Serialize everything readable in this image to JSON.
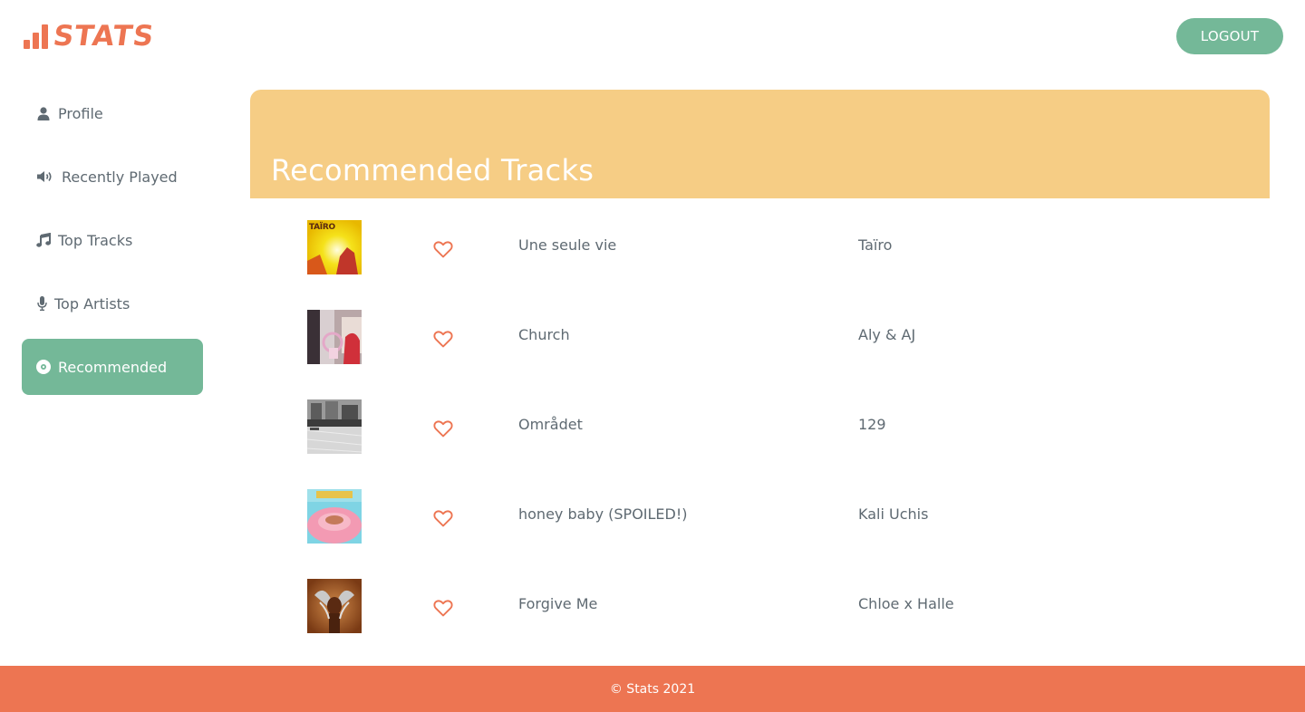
{
  "header": {
    "logo_text": "STATS",
    "logout_label": "LOGOUT"
  },
  "sidebar": {
    "items": [
      {
        "label": "Profile",
        "icon": "user-icon"
      },
      {
        "label": "Recently Played",
        "icon": "speaker-icon"
      },
      {
        "label": "Top Tracks",
        "icon": "music-note-icon"
      },
      {
        "label": "Top Artists",
        "icon": "microphone-icon"
      },
      {
        "label": "Recommended",
        "icon": "disc-icon",
        "active": true
      }
    ]
  },
  "main": {
    "title": "Recommended Tracks",
    "tracks": [
      {
        "title": "Une seule vie",
        "artist": "Taïro",
        "cover_label": "TAÏRO"
      },
      {
        "title": "Church",
        "artist": "Aly & AJ"
      },
      {
        "title": "Området",
        "artist": "129"
      },
      {
        "title": "honey baby (SPOILED!)",
        "artist": "Kali Uchis"
      },
      {
        "title": "Forgive Me",
        "artist": "Chloe x Halle"
      }
    ]
  },
  "footer": {
    "text": "© Stats 2021"
  },
  "colors": {
    "accent": "#ed7552",
    "green": "#74b898",
    "banner": "#f6cd85",
    "text": "#5f6a72"
  }
}
